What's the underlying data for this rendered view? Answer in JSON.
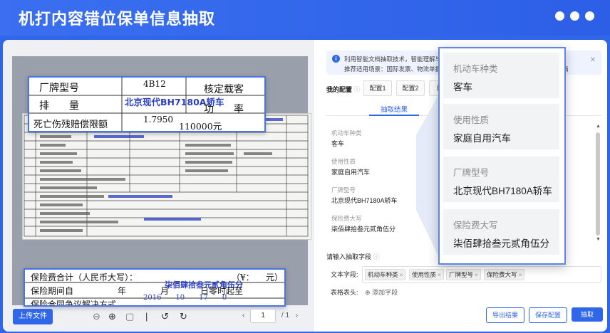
{
  "header": {
    "title": "机打内容错位保单信息抽取"
  },
  "viewer": {
    "zoom_top": {
      "row1_label": "厂牌型号",
      "row1_code": "4B12",
      "row1_right": "核定载客",
      "row2_label": "排　　量",
      "row2_stamp": "北京现代BH7180A轿车",
      "row2_right": "功　　率",
      "row3_label": "死亡伤残赔偿限额",
      "row3_num": "1.7950",
      "row3_amount": "110000元"
    },
    "zoom_bottom": {
      "row1_label": "保险费合计（人民币大写）：",
      "row1_yen": "（¥：",
      "row1_end": "元）",
      "row1_stamp": "柒佰肆拾叁元贰角伍分",
      "row2_label": "保险期间自",
      "row2_year": "年",
      "row2_month": "月",
      "row2_day": "日零时起至",
      "row2_date": "2016　　10　　17　　0",
      "row3_label": "保险合同争议解决方式"
    },
    "upload_label": "上传文件",
    "pager": {
      "current": "1",
      "total": "/ 1"
    }
  },
  "panel": {
    "info_line1": "利用智能文档抽取技术，智能理解与抽取各类文档中的关键信息",
    "info_line2": "推荐适用场景：国际发票、物流单据、信贷材料、采购合同等各类不固定版式的文档",
    "config_label": "我的配置",
    "config_tabs": [
      "配置1",
      "配置2",
      "配置"
    ],
    "result_tab": "抽取结果",
    "fields": [
      {
        "label": "机动车种类",
        "value": "客车"
      },
      {
        "label": "使用性质",
        "value": "家庭自用汽车"
      },
      {
        "label": "厂牌型号",
        "value": "北京现代BH7180A轿车"
      },
      {
        "label": "保险费大写",
        "value": "柒佰肆拾叁元贰角伍分"
      }
    ],
    "input_label": "请输入抽取字段",
    "text_field_label": "文本字段:",
    "chips": [
      "机动车种类",
      "使用性质",
      "厂牌型号",
      "保险费大写"
    ],
    "table_label": "表格表头:",
    "add_field": "添加字段",
    "buttons": {
      "export": "导出结果",
      "save": "保存配置",
      "extract": "抽取"
    }
  },
  "popup": {
    "items": [
      {
        "label": "机动车种类",
        "value": "客车"
      },
      {
        "label": "使用性质",
        "value": "家庭自用汽车"
      },
      {
        "label": "厂牌型号",
        "value": "北京现代BH7180A轿车"
      },
      {
        "label": "保险费大写",
        "value": "柒佰肆拾叁元贰角伍分"
      }
    ]
  }
}
